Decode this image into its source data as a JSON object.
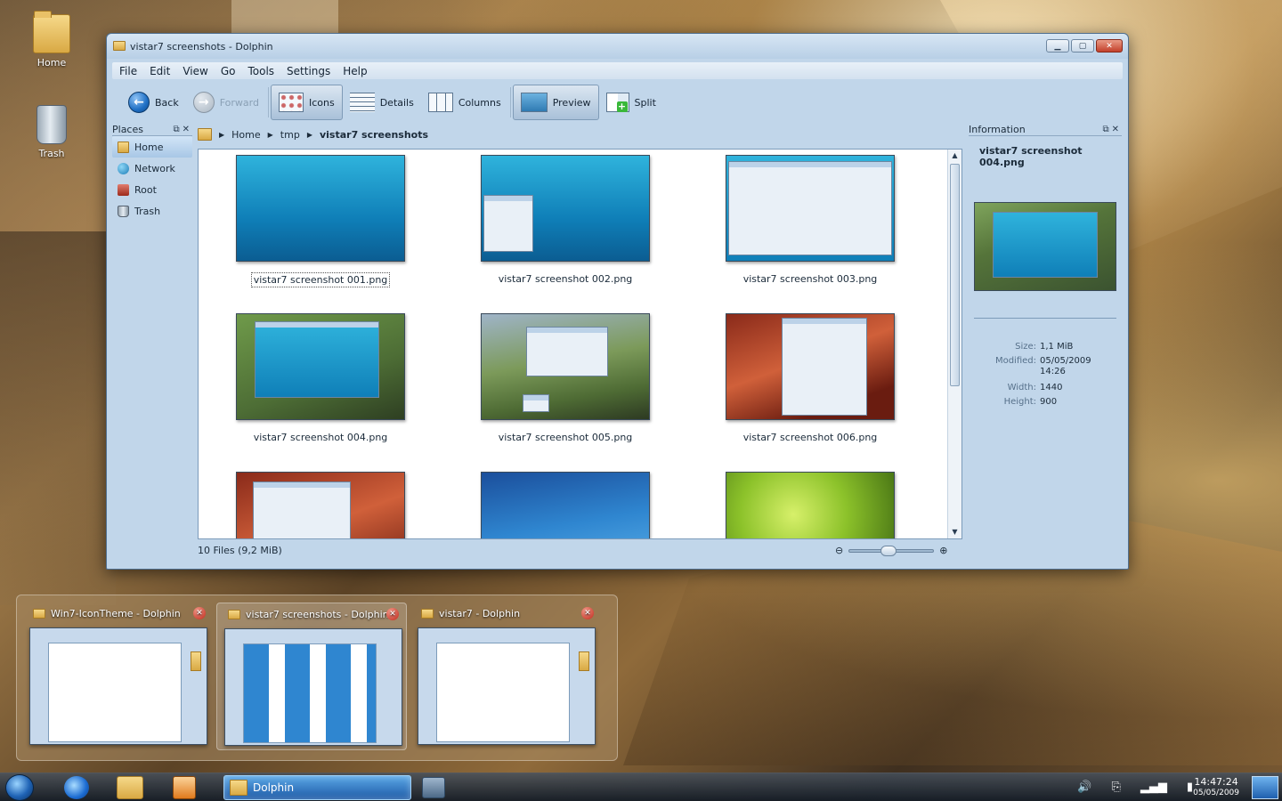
{
  "desktop": {
    "icons": [
      {
        "label": "Home",
        "icon": "home-folder-icon"
      },
      {
        "label": "Trash",
        "icon": "trash-icon"
      }
    ]
  },
  "window": {
    "title": "vistar7 screenshots - Dolphin",
    "menu": [
      "File",
      "Edit",
      "View",
      "Go",
      "Tools",
      "Settings",
      "Help"
    ],
    "toolbar": {
      "back": "Back",
      "forward": "Forward",
      "icons": "Icons",
      "details": "Details",
      "columns": "Columns",
      "preview": "Preview",
      "split": "Split"
    },
    "places": {
      "title": "Places",
      "items": [
        "Home",
        "Network",
        "Root",
        "Trash"
      ]
    },
    "breadcrumb": [
      "Home",
      "tmp",
      "vistar7 screenshots"
    ],
    "files": [
      "vistar7 screenshot 001.png",
      "vistar7 screenshot 002.png",
      "vistar7 screenshot 003.png",
      "vistar7 screenshot 004.png",
      "vistar7 screenshot 005.png",
      "vistar7 screenshot 006.png"
    ],
    "status": "10 Files (9,2 MiB)",
    "zoom_level": 0.45,
    "information": {
      "title": "Information",
      "filename": "vistar7 screenshot 004.png",
      "meta": {
        "size_label": "Size:",
        "size": "1,1 MiB",
        "modified_label": "Modified:",
        "modified_date": "05/05/2009",
        "modified_time": "14:26",
        "width_label": "Width:",
        "width": "1440",
        "height_label": "Height:",
        "height": "900"
      }
    }
  },
  "switcher": [
    {
      "title": "Win7-IconTheme - Dolphin"
    },
    {
      "title": "vistar7 screenshots - Dolphin"
    },
    {
      "title": "vistar7 - Dolphin"
    }
  ],
  "taskbar": {
    "active_task": "Dolphin",
    "clock_time": "14:47:24",
    "clock_date": "05/05/2009"
  },
  "colors": {
    "window_bg": "#c1d6ea",
    "selection": "#a8c7e6",
    "close_red": "#c3402a"
  }
}
